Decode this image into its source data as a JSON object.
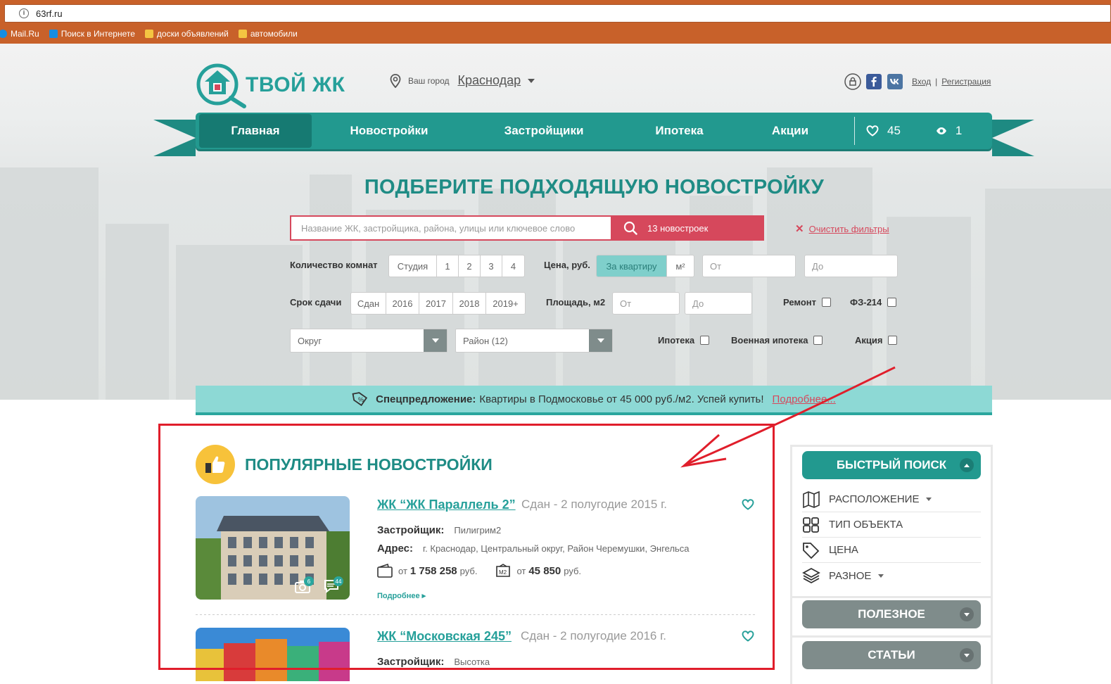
{
  "browser": {
    "url": "63rf.ru",
    "bookmarks": [
      {
        "label": "Mail.Ru",
        "icon": "mailru-icon",
        "color": "#168de2"
      },
      {
        "label": "Поиск в Интернете",
        "icon": "search-icon",
        "color": "#168de2"
      },
      {
        "label": "доски объявлений",
        "icon": "folder-icon",
        "color": "#f4c542"
      },
      {
        "label": "автомобили",
        "icon": "folder-icon",
        "color": "#f4c542"
      }
    ]
  },
  "header": {
    "logo_text": "ТВОЙ ЖК",
    "city_label": "Ваш город",
    "city_value": "Краснодар",
    "login": "Вход",
    "register": "Регистрация",
    "separator": "|"
  },
  "nav": {
    "items": [
      "Главная",
      "Новостройки",
      "Застройщики",
      "Ипотека",
      "Акции"
    ],
    "favorites_count": "45",
    "views_count": "1"
  },
  "search": {
    "headline": "ПОДБЕРИТЕ ПОДХОДЯЩУЮ НОВОСТРОЙКУ",
    "placeholder": "Название ЖК, застройщика, района, улицы или ключевое слово",
    "button": "13 новостроек",
    "clear": "Очистить фильтры"
  },
  "filters": {
    "rooms_label": "Количество комнат",
    "rooms": [
      "Студия",
      "1",
      "2",
      "3",
      "4"
    ],
    "price_label": "Цена, руб.",
    "price_modes": [
      "За квартиру",
      "м²"
    ],
    "price_from": "От",
    "price_to": "До",
    "deadline_label": "Срок сдачи",
    "deadlines": [
      "Сдан",
      "2016",
      "2017",
      "2018",
      "2019+"
    ],
    "area_label": "Площадь, м2",
    "area_from": "От",
    "area_to": "До",
    "repair": "Ремонт",
    "fz214": "ФЗ-214",
    "district": "Округ",
    "area_select": "Район (12)",
    "mortgage": "Ипотека",
    "military": "Военная ипотека",
    "promo": "Акция"
  },
  "promo_bar": {
    "bold": "Спецпредложение:",
    "text": "Квартиры в Подмосковье от 45 000 руб./м2. Успей купить!",
    "link": "Подробнее..."
  },
  "popular": {
    "title": "ПОПУЛЯРНЫЕ НОВОСТРОЙКИ",
    "listings": [
      {
        "title": "ЖК “ЖК Параллель 2”",
        "status": "Сдан - 2 полугодие 2015 г.",
        "developer_label": "Застройщик:",
        "developer": "Пилигрим2",
        "address_label": "Адрес:",
        "address": "г. Краснодар, Центральный округ, Район Черемушки, Энгельса",
        "price_prefix": "от",
        "price": "1 758 258",
        "price_unit": "руб.",
        "sqm_prefix": "от",
        "sqm_price": "45 850",
        "sqm_unit": "руб.",
        "more": "Подробнее",
        "photos_count": "6",
        "comments_count": "44"
      },
      {
        "title": "ЖК “Московская 245”",
        "status": "Сдан - 2 полугодие 2016 г.",
        "developer_label": "Застройщик:",
        "developer": "Высотка"
      }
    ]
  },
  "sidebar": {
    "quick_search": "БЫСТРЫЙ ПОИСК",
    "items": [
      "РАСПОЛОЖЕНИЕ",
      "ТИП ОБЪЕКТА",
      "ЦЕНА",
      "РАЗНОЕ"
    ],
    "useful": "ПОЛЕЗНОЕ",
    "articles": "СТАТЬИ"
  },
  "colors": {
    "teal": "#22998f",
    "red": "#d6485c",
    "promo_bg": "#8dd9d5",
    "grey_button": "#7f8c8b",
    "annotation_red": "#e01e2b"
  }
}
